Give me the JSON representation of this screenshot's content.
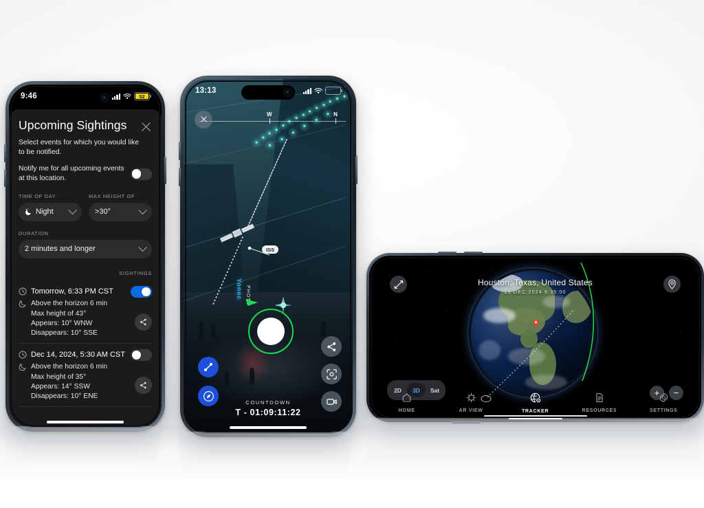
{
  "scene": {
    "description": "Three iPhone mockups showing an ISS tracking app: upcoming sightings list, AR sky view, and 3D globe tracker."
  },
  "phone1": {
    "status": {
      "time": "9:46",
      "battery_percent": "52",
      "battery_low_power": true,
      "signal_icon": "cellular-signal-icon",
      "wifi_icon": "wifi-icon"
    },
    "sheet": {
      "title": "Upcoming Sightings",
      "close_icon": "close-icon",
      "subtitle": "Select events for which you would like to be notified.",
      "notify_label": "Notify me for all upcoming events at this location.",
      "notify_on": false
    },
    "filters": {
      "time_of_day": {
        "label": "TIME OF DAY",
        "value": "Night",
        "icon": "moon-icon",
        "chevron": "chevron-down-icon"
      },
      "max_height": {
        "label": "MAX HEIGHT OF",
        "value": ">30°",
        "chevron": "chevron-down-icon"
      },
      "duration": {
        "label": "DURATION",
        "value": "2 minutes and longer",
        "chevron": "chevron-down-icon"
      }
    },
    "sightings_label": "SIGHTINGS",
    "sightings": [
      {
        "time": "Tomorrow, 6:33 PM CST",
        "duration": "Above the horizon 6 min",
        "max_height": "Max height of 43°",
        "appears": "Appears: 10° WNW",
        "disappears": "Disappears: 10° SSE",
        "enabled": true,
        "clock_icon": "clock-icon",
        "moon_icon": "moon-icon",
        "share_icon": "share-icon"
      },
      {
        "time": "Dec 14, 2024, 5:30 AM CST",
        "duration": "Above the horizon 6 min",
        "max_height": "Max height of 35°",
        "appears": "Appears: 14° SSW",
        "disappears": "Disappears: 10° ENE",
        "enabled": false,
        "clock_icon": "clock-icon",
        "moon_icon": "moon-icon",
        "share_icon": "share-icon"
      }
    ],
    "colors": {
      "toggle_on": "#0a6ce0",
      "sheet_bg": "#1b1b1d",
      "field_bg": "#2c2c2e"
    }
  },
  "phone2": {
    "status": {
      "time": "13:13",
      "signal_icon": "cellular-signal-icon",
      "wifi_icon": "wifi-icon",
      "battery_icon": "battery-icon"
    },
    "close_icon": "close-icon",
    "compass": {
      "labels": [
        "W",
        "N"
      ]
    },
    "satellite_label": "ISS",
    "target_ring_color": "#1fd855",
    "sign_text": "Yonec",
    "sign_sub": "PHOTO",
    "controls": {
      "path_icon": "orbit-path-icon",
      "compass_icon": "compass-icon",
      "share_icon": "share-icon",
      "focus_icon": "focus-target-icon",
      "video_icon": "video-camera-icon"
    },
    "countdown": {
      "label": "COUNTDOWN",
      "value": "T - 01:09:11:22"
    },
    "colors": {
      "accent_blue": "#1e4fd8",
      "ring_green": "#1fd855"
    }
  },
  "phone3": {
    "title": "Houston, Texas, United States",
    "date": "13 DEC 2024 9:35:00",
    "expand_icon": "expand-icon",
    "locate_icon": "location-pin-icon",
    "view_modes": [
      {
        "label": "2D",
        "active": false
      },
      {
        "label": "3D",
        "active": true
      },
      {
        "label": "Sat",
        "active": false
      }
    ],
    "zoom_in": "+",
    "zoom_out": "−",
    "orbit_track_color": "#2fd84a",
    "nav": [
      {
        "label": "HOME",
        "icon": "home-icon",
        "active": false
      },
      {
        "label": "AR VIEW",
        "icon": "ar-view-icon",
        "active": false
      },
      {
        "label": "TRACKER",
        "icon": "tracker-globe-icon",
        "active": true
      },
      {
        "label": "RESOURCES",
        "icon": "document-icon",
        "active": false
      },
      {
        "label": "SETTINGS",
        "icon": "gear-icon",
        "active": false
      }
    ],
    "colors": {
      "active_mode": "#5b9cf0",
      "pin": "#e8432c"
    }
  }
}
